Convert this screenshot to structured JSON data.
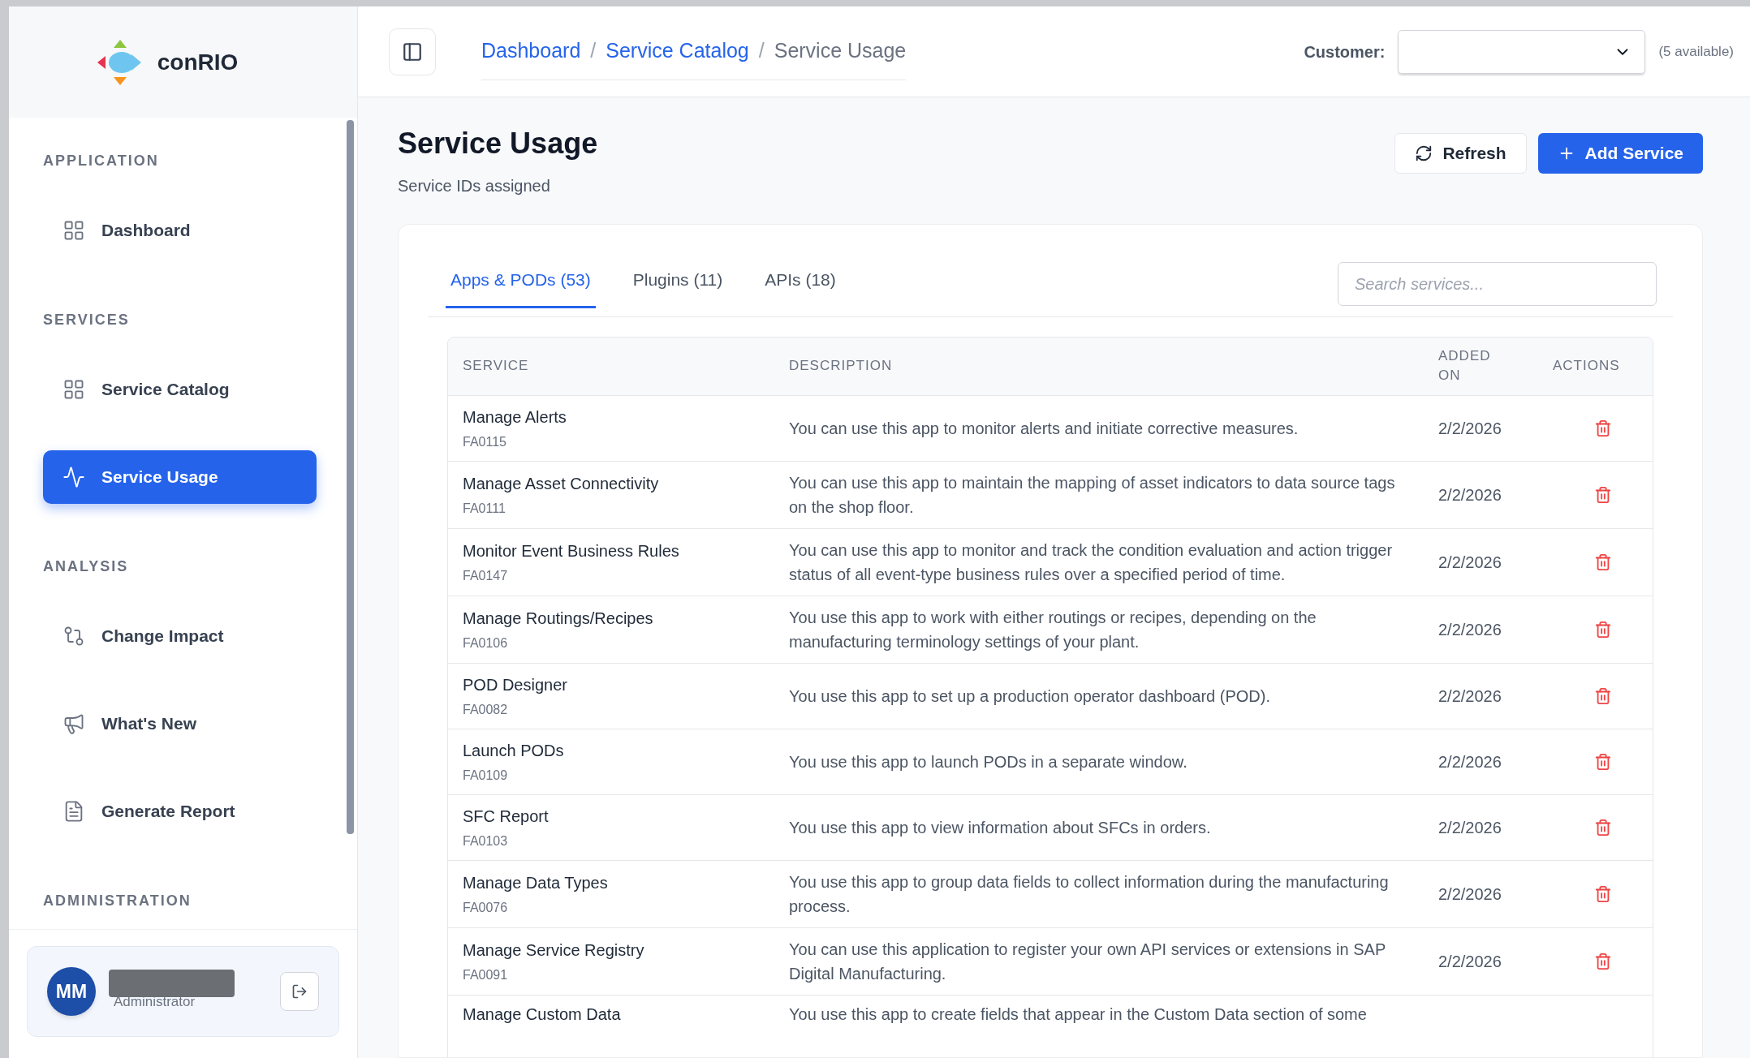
{
  "brand": "conRIO",
  "sidebar": {
    "sections": [
      {
        "title": "APPLICATION",
        "items": [
          {
            "label": "Dashboard",
            "selected": false
          }
        ]
      },
      {
        "title": "SERVICES",
        "items": [
          {
            "label": "Service Catalog",
            "selected": false
          },
          {
            "label": "Service Usage",
            "selected": true
          }
        ]
      },
      {
        "title": "ANALYSIS",
        "items": [
          {
            "label": "Change Impact",
            "selected": false
          },
          {
            "label": "What's New",
            "selected": false
          },
          {
            "label": "Generate Report",
            "selected": false
          }
        ]
      },
      {
        "title": "ADMINISTRATION"
      }
    ],
    "user": {
      "initials": "MM",
      "role": "Administrator"
    }
  },
  "breadcrumb": [
    "Dashboard",
    "Service Catalog",
    "Service Usage"
  ],
  "breadcrumb_separators": [
    "/",
    "/"
  ],
  "customer": {
    "label": "Customer:",
    "available": "(5 available)"
  },
  "page": {
    "title": "Service Usage",
    "subtitle": "Service IDs assigned",
    "buttons": [
      "Refresh",
      "Add Service"
    ]
  },
  "tabs": [
    {
      "label": "Apps & PODs (53)",
      "selected": true
    },
    {
      "label": "Plugins (11)",
      "selected": false
    },
    {
      "label": "APIs (18)",
      "selected": false
    }
  ],
  "search": {
    "placeholder": "Search services..."
  },
  "table": {
    "columns": [
      "SERVICE",
      "DESCRIPTION",
      "ADDED ON",
      "ACTIONS"
    ],
    "rows": [
      {
        "name": "Manage Alerts",
        "id": "FA0115",
        "description": "You can use this app to monitor alerts and initiate corrective measures.",
        "added": "2/2/2026"
      },
      {
        "name": "Manage Asset Connectivity",
        "id": "FA0111",
        "description": "You can use this app to maintain the mapping of asset indicators to data source tags on the shop floor.",
        "added": "2/2/2026"
      },
      {
        "name": "Monitor Event Business Rules",
        "id": "FA0147",
        "description": "You can use this app to monitor and track the condition evaluation and action trigger status of all event-type business rules over a specified period of time.",
        "added": "2/2/2026"
      },
      {
        "name": "Manage Routings/Recipes",
        "id": "FA0106",
        "description": "You use this app to work with either routings or recipes, depending on the manufacturing terminology settings of your plant.",
        "added": "2/2/2026"
      },
      {
        "name": "POD Designer",
        "id": "FA0082",
        "description": "You use this app to set up a production operator dashboard (POD).",
        "added": "2/2/2026"
      },
      {
        "name": "Launch PODs",
        "id": "FA0109",
        "description": "You use this app to launch PODs in a separate window.",
        "added": "2/2/2026"
      },
      {
        "name": "SFC Report",
        "id": "FA0103",
        "description": "You use this app to view information about SFCs in orders.",
        "added": "2/2/2026"
      },
      {
        "name": "Manage Data Types",
        "id": "FA0076",
        "description": "You use this app to group data fields to collect information during the manufacturing process.",
        "added": "2/2/2026"
      },
      {
        "name": "Manage Service Registry",
        "id": "FA0091",
        "description": "You can use this application to register your own API services or extensions in SAP Digital Manufacturing.",
        "added": "2/2/2026"
      },
      {
        "name": "Manage Custom Data",
        "description": "You use this app to create fields that appear in the Custom Data section of some"
      }
    ]
  }
}
